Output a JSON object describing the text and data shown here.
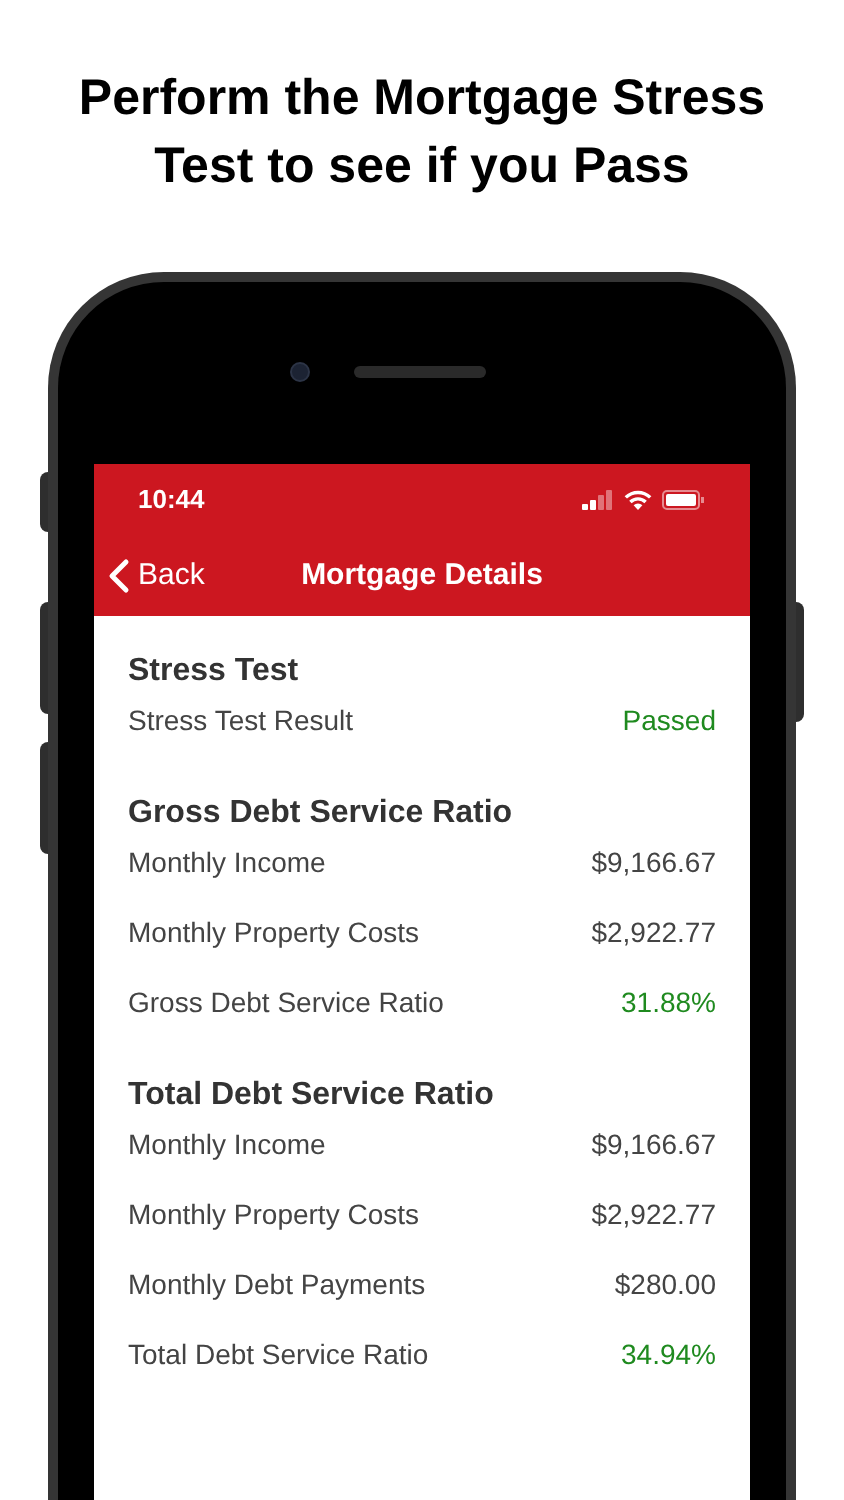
{
  "headline": {
    "lines": [
      "Perform the Mortgage Stress",
      "Test to see if you Pass"
    ]
  },
  "status_bar": {
    "time": "10:44"
  },
  "nav": {
    "back": "Back",
    "title": "Mortgage Details"
  },
  "sections": [
    {
      "title": "Stress Test",
      "rows": [
        {
          "label": "Stress Test Result",
          "value": "Passed",
          "highlighted": true
        }
      ]
    },
    {
      "title": "Gross Debt Service Ratio",
      "rows": [
        {
          "label": "Monthly Income",
          "value": "$9,166.67",
          "highlighted": false
        },
        {
          "label": "Monthly Property Costs",
          "value": "$2,922.77",
          "highlighted": false
        },
        {
          "label": "Gross Debt Service Ratio",
          "value": "31.88%",
          "highlighted": true
        }
      ]
    },
    {
      "title": "Total Debt Service Ratio",
      "rows": [
        {
          "label": "Monthly Income",
          "value": "$9,166.67",
          "highlighted": false
        },
        {
          "label": "Monthly Property Costs",
          "value": "$2,922.77",
          "highlighted": false
        },
        {
          "label": "Monthly Debt Payments",
          "value": "$280.00",
          "highlighted": false
        },
        {
          "label": "Total Debt Service Ratio",
          "value": "34.94%",
          "highlighted": true
        }
      ]
    }
  ]
}
